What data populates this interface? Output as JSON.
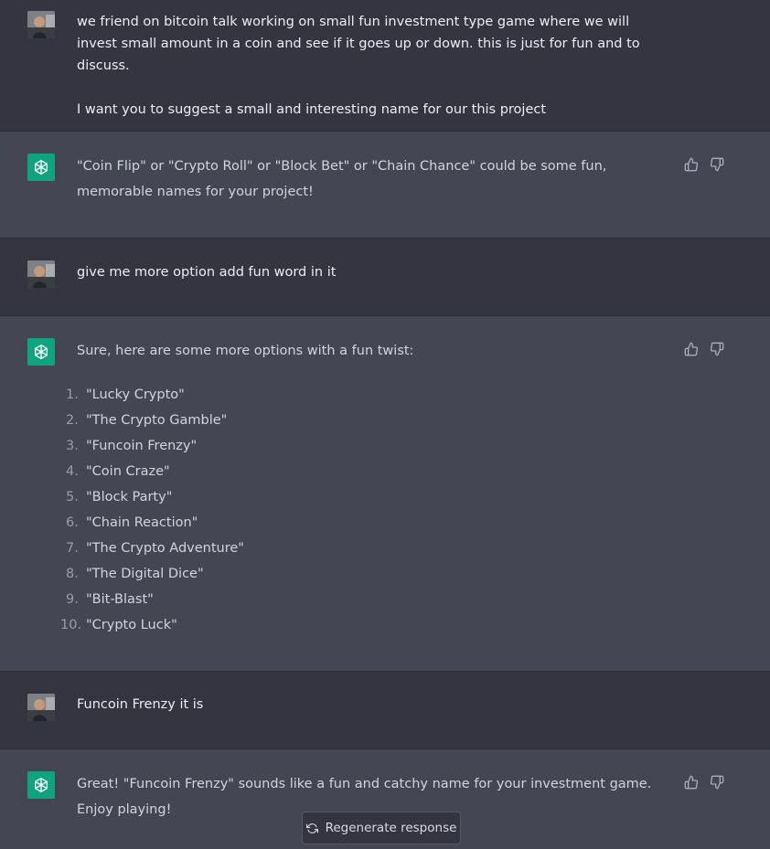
{
  "colors": {
    "user_bg": "#343541",
    "assistant_bg": "#444654",
    "bot_avatar": "#10a37f"
  },
  "icons": {
    "bot": "openai-logo-icon",
    "like": "thumbs-up-icon",
    "dislike": "thumbs-down-icon",
    "regenerate": "refresh-icon"
  },
  "messages": [
    {
      "role": "user",
      "paragraphs": [
        "we friend on bitcoin talk working on small fun investment type game where we will invest small amount in a coin and see if it goes up or down. this is just for fun and to discuss.",
        "I want you to suggest a small and interesting name for our this project"
      ]
    },
    {
      "role": "assistant",
      "text": "\"Coin Flip\" or \"Crypto Roll\" or \"Block Bet\" or \"Chain Chance\" could be some fun, memorable names for your project!"
    },
    {
      "role": "user",
      "text": "give me more option add fun word in it"
    },
    {
      "role": "assistant",
      "intro": "Sure, here are some more options with a fun twist:",
      "list": [
        {
          "num": "1.",
          "text": "\"Lucky Crypto\""
        },
        {
          "num": "2.",
          "text": "\"The Crypto Gamble\""
        },
        {
          "num": "3.",
          "text": "\"Funcoin Frenzy\""
        },
        {
          "num": "4.",
          "text": "\"Coin Craze\""
        },
        {
          "num": "5.",
          "text": "\"Block Party\""
        },
        {
          "num": "6.",
          "text": "\"Chain Reaction\""
        },
        {
          "num": "7.",
          "text": "\"The Crypto Adventure\""
        },
        {
          "num": "8.",
          "text": "\"The Digital Dice\""
        },
        {
          "num": "9.",
          "text": "\"Bit-Blast\""
        },
        {
          "num": "10.",
          "text": "\"Crypto Luck\""
        }
      ]
    },
    {
      "role": "user",
      "text": "Funcoin Frenzy it is"
    },
    {
      "role": "assistant",
      "text": "Great! \"Funcoin Frenzy\" sounds like a fun and catchy name for your investment game. Enjoy playing!"
    }
  ],
  "regenerate_label": "Regenerate response"
}
